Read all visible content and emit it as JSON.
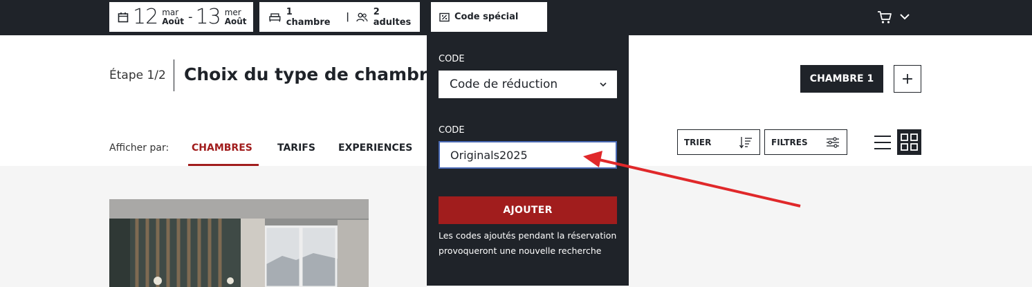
{
  "topbar": {
    "checkin": {
      "day": "12",
      "weekday": "mar",
      "month": "Août"
    },
    "separator": "-",
    "checkout": {
      "day": "13",
      "weekday": "mer",
      "month": "Août"
    },
    "rooms": "1 chambre",
    "divider": "|",
    "guests": "2 adultes",
    "special_code": "Code spécial",
    "icons": [
      "calendar-icon",
      "bed-icon",
      "people-icon",
      "discount-icon",
      "cart-icon",
      "chevron-down-icon"
    ]
  },
  "header": {
    "step": "Étape 1/2",
    "title": "Choix du type de chambre",
    "room_button": "CHAMBRE 1",
    "add_room": "+"
  },
  "view": {
    "label": "Afficher par:",
    "tabs": [
      {
        "label": "CHAMBRES",
        "active": true
      },
      {
        "label": "TARIFS",
        "active": false
      },
      {
        "label": "EXPERIENCES",
        "active": false
      }
    ],
    "sort": "TRIER",
    "filters": "FILTRES"
  },
  "panel": {
    "type_label": "CODE",
    "type_value": "Code de réduction",
    "code_label": "CODE",
    "code_value": "Originals2025",
    "add_button": "AJOUTER",
    "note": "Les codes ajoutés pendant la réservation provoqueront une nouvelle recherche"
  },
  "colors": {
    "dark": "#1f2329",
    "accent_red": "#a11d1d",
    "annotation_arrow": "#e0282a",
    "input_focus": "#4a6ab5"
  }
}
